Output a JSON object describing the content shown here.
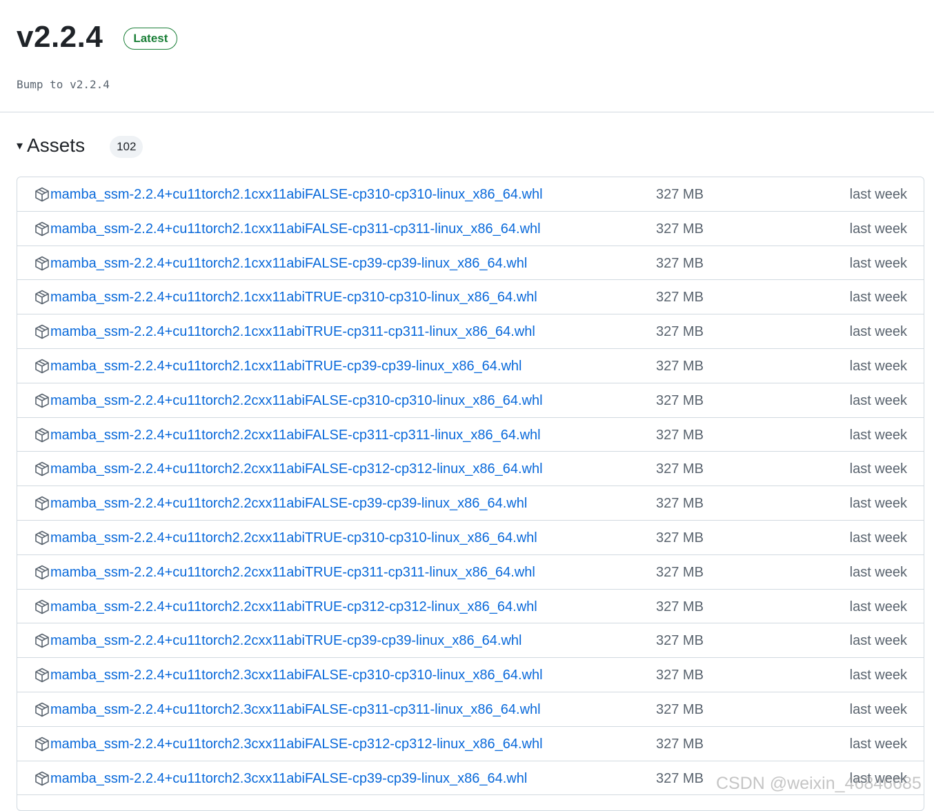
{
  "release": {
    "title": "v2.2.4",
    "badge": "Latest",
    "notes": "Bump to v2.2.4"
  },
  "assets": {
    "caret": "▾",
    "title": "Assets",
    "count": "102",
    "items": [
      {
        "name": "mamba_ssm-2.2.4+cu11torch2.1cxx11abiFALSE-cp310-cp310-linux_x86_64.whl",
        "size": "327 MB",
        "date": "last week"
      },
      {
        "name": "mamba_ssm-2.2.4+cu11torch2.1cxx11abiFALSE-cp311-cp311-linux_x86_64.whl",
        "size": "327 MB",
        "date": "last week"
      },
      {
        "name": "mamba_ssm-2.2.4+cu11torch2.1cxx11abiFALSE-cp39-cp39-linux_x86_64.whl",
        "size": "327 MB",
        "date": "last week"
      },
      {
        "name": "mamba_ssm-2.2.4+cu11torch2.1cxx11abiTRUE-cp310-cp310-linux_x86_64.whl",
        "size": "327 MB",
        "date": "last week"
      },
      {
        "name": "mamba_ssm-2.2.4+cu11torch2.1cxx11abiTRUE-cp311-cp311-linux_x86_64.whl",
        "size": "327 MB",
        "date": "last week"
      },
      {
        "name": "mamba_ssm-2.2.4+cu11torch2.1cxx11abiTRUE-cp39-cp39-linux_x86_64.whl",
        "size": "327 MB",
        "date": "last week"
      },
      {
        "name": "mamba_ssm-2.2.4+cu11torch2.2cxx11abiFALSE-cp310-cp310-linux_x86_64.whl",
        "size": "327 MB",
        "date": "last week"
      },
      {
        "name": "mamba_ssm-2.2.4+cu11torch2.2cxx11abiFALSE-cp311-cp311-linux_x86_64.whl",
        "size": "327 MB",
        "date": "last week"
      },
      {
        "name": "mamba_ssm-2.2.4+cu11torch2.2cxx11abiFALSE-cp312-cp312-linux_x86_64.whl",
        "size": "327 MB",
        "date": "last week"
      },
      {
        "name": "mamba_ssm-2.2.4+cu11torch2.2cxx11abiFALSE-cp39-cp39-linux_x86_64.whl",
        "size": "327 MB",
        "date": "last week"
      },
      {
        "name": "mamba_ssm-2.2.4+cu11torch2.2cxx11abiTRUE-cp310-cp310-linux_x86_64.whl",
        "size": "327 MB",
        "date": "last week"
      },
      {
        "name": "mamba_ssm-2.2.4+cu11torch2.2cxx11abiTRUE-cp311-cp311-linux_x86_64.whl",
        "size": "327 MB",
        "date": "last week"
      },
      {
        "name": "mamba_ssm-2.2.4+cu11torch2.2cxx11abiTRUE-cp312-cp312-linux_x86_64.whl",
        "size": "327 MB",
        "date": "last week"
      },
      {
        "name": "mamba_ssm-2.2.4+cu11torch2.2cxx11abiTRUE-cp39-cp39-linux_x86_64.whl",
        "size": "327 MB",
        "date": "last week"
      },
      {
        "name": "mamba_ssm-2.2.4+cu11torch2.3cxx11abiFALSE-cp310-cp310-linux_x86_64.whl",
        "size": "327 MB",
        "date": "last week"
      },
      {
        "name": "mamba_ssm-2.2.4+cu11torch2.3cxx11abiFALSE-cp311-cp311-linux_x86_64.whl",
        "size": "327 MB",
        "date": "last week"
      },
      {
        "name": "mamba_ssm-2.2.4+cu11torch2.3cxx11abiFALSE-cp312-cp312-linux_x86_64.whl",
        "size": "327 MB",
        "date": "last week"
      },
      {
        "name": "mamba_ssm-2.2.4+cu11torch2.3cxx11abiFALSE-cp39-cp39-linux_x86_64.whl",
        "size": "327 MB",
        "date": "last week"
      }
    ]
  },
  "watermark": "CSDN @weixin_46846685",
  "icons": {
    "asset": "package-icon",
    "toggle": "triangle-down-icon"
  },
  "colors": {
    "link": "#0969da",
    "badge": "#1a7f37",
    "muted": "#59636e",
    "border": "#d1d9e0"
  }
}
